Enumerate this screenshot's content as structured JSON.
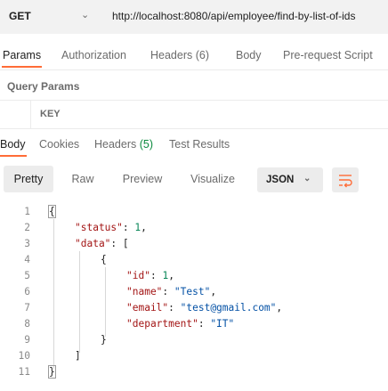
{
  "request": {
    "method": "GET",
    "url": "http://localhost:8080/api/employee/find-by-list-of-ids"
  },
  "request_tabs": [
    {
      "label": "Params"
    },
    {
      "label": "Authorization"
    },
    {
      "label": "Headers (6)"
    },
    {
      "label": "Body"
    },
    {
      "label": "Pre-request Script"
    }
  ],
  "query_params": {
    "title": "Query Params",
    "key_header": "KEY"
  },
  "response_tabs": {
    "body": "Body",
    "cookies": "Cookies",
    "headers_label": "Headers",
    "headers_count": "(5)",
    "test_results": "Test Results"
  },
  "view_modes": [
    {
      "label": "Pretty"
    },
    {
      "label": "Raw"
    },
    {
      "label": "Preview"
    },
    {
      "label": "Visualize"
    }
  ],
  "format_select": "JSON",
  "line_numbers": [
    "1",
    "2",
    "3",
    "4",
    "5",
    "6",
    "7",
    "8",
    "9",
    "10",
    "11"
  ],
  "response_body": {
    "status_key": "\"status\"",
    "status_val": "1",
    "data_key": "\"data\"",
    "id_key": "\"id\"",
    "id_val": "1",
    "name_key": "\"name\"",
    "name_val": "\"Test\"",
    "email_key": "\"email\"",
    "email_val": "\"test@gmail.com\"",
    "department_key": "\"department\"",
    "department_val": "\"IT\""
  },
  "colors": {
    "accent": "#ff6c37",
    "json_key": "#a31515",
    "json_string": "#0451a5",
    "json_number": "#098658"
  }
}
